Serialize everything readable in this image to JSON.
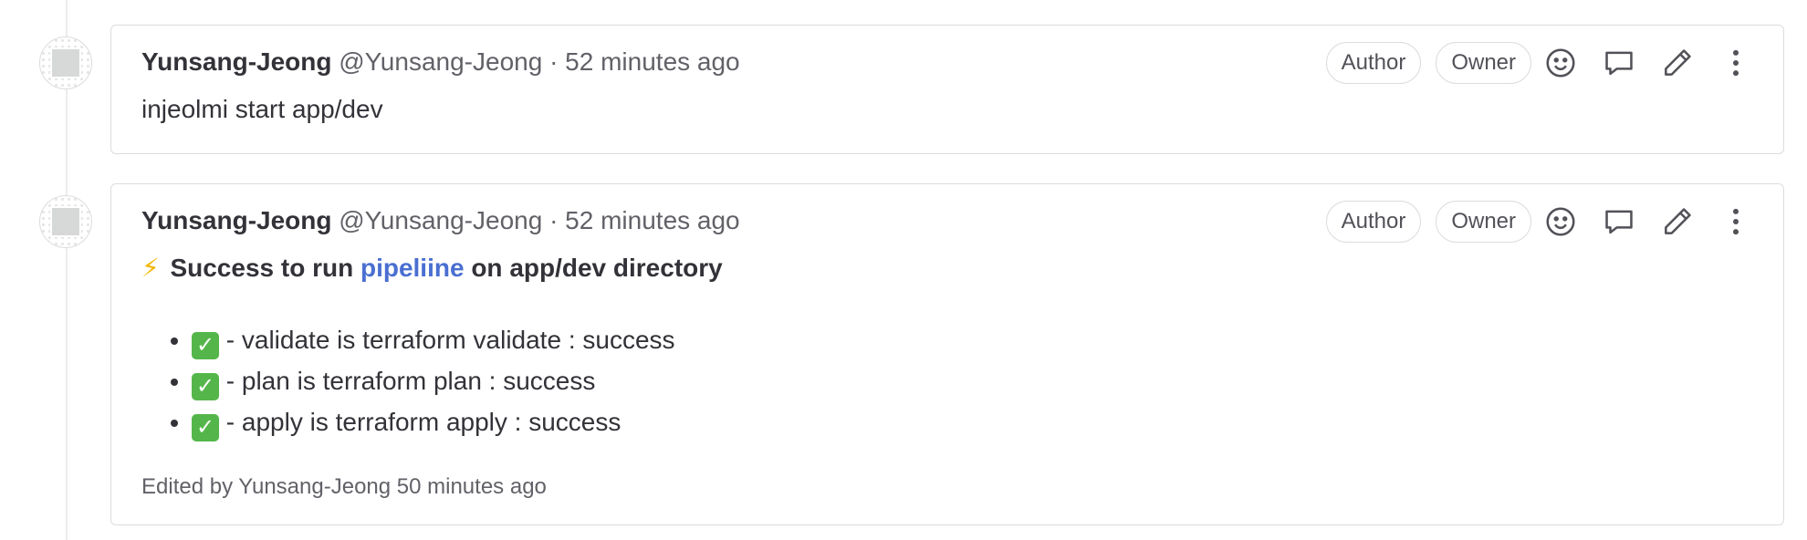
{
  "notes": [
    {
      "author_name": "Yunsang-Jeong",
      "author_handle": "@Yunsang-Jeong",
      "separator": "·",
      "time": "52 minutes ago",
      "badges": [
        "Author",
        "Owner"
      ],
      "text": "injeolmi start app/dev"
    },
    {
      "author_name": "Yunsang-Jeong",
      "author_handle": "@Yunsang-Jeong",
      "separator": "·",
      "time": "52 minutes ago",
      "badges": [
        "Author",
        "Owner"
      ],
      "summary": {
        "icon": "⚡",
        "prefix": "Success to run",
        "link_text": "pipeliine",
        "suffix": "on app/dev directory"
      },
      "results": [
        {
          "check": "✓",
          "text": "- validate is terraform validate : success"
        },
        {
          "check": "✓",
          "text": "- plan is terraform plan : success"
        },
        {
          "check": "✓",
          "text": "- apply is terraform apply : success"
        }
      ],
      "edited": "Edited by Yunsang-Jeong 50 minutes ago"
    }
  ],
  "icons": {
    "emoji": "smiley-icon",
    "reply": "comment-icon",
    "edit": "pencil-icon",
    "more": "kebab-menu-icon"
  },
  "colors": {
    "link": "#4a6fd1",
    "bolt": "#f2b705",
    "check": "#54b64a"
  }
}
